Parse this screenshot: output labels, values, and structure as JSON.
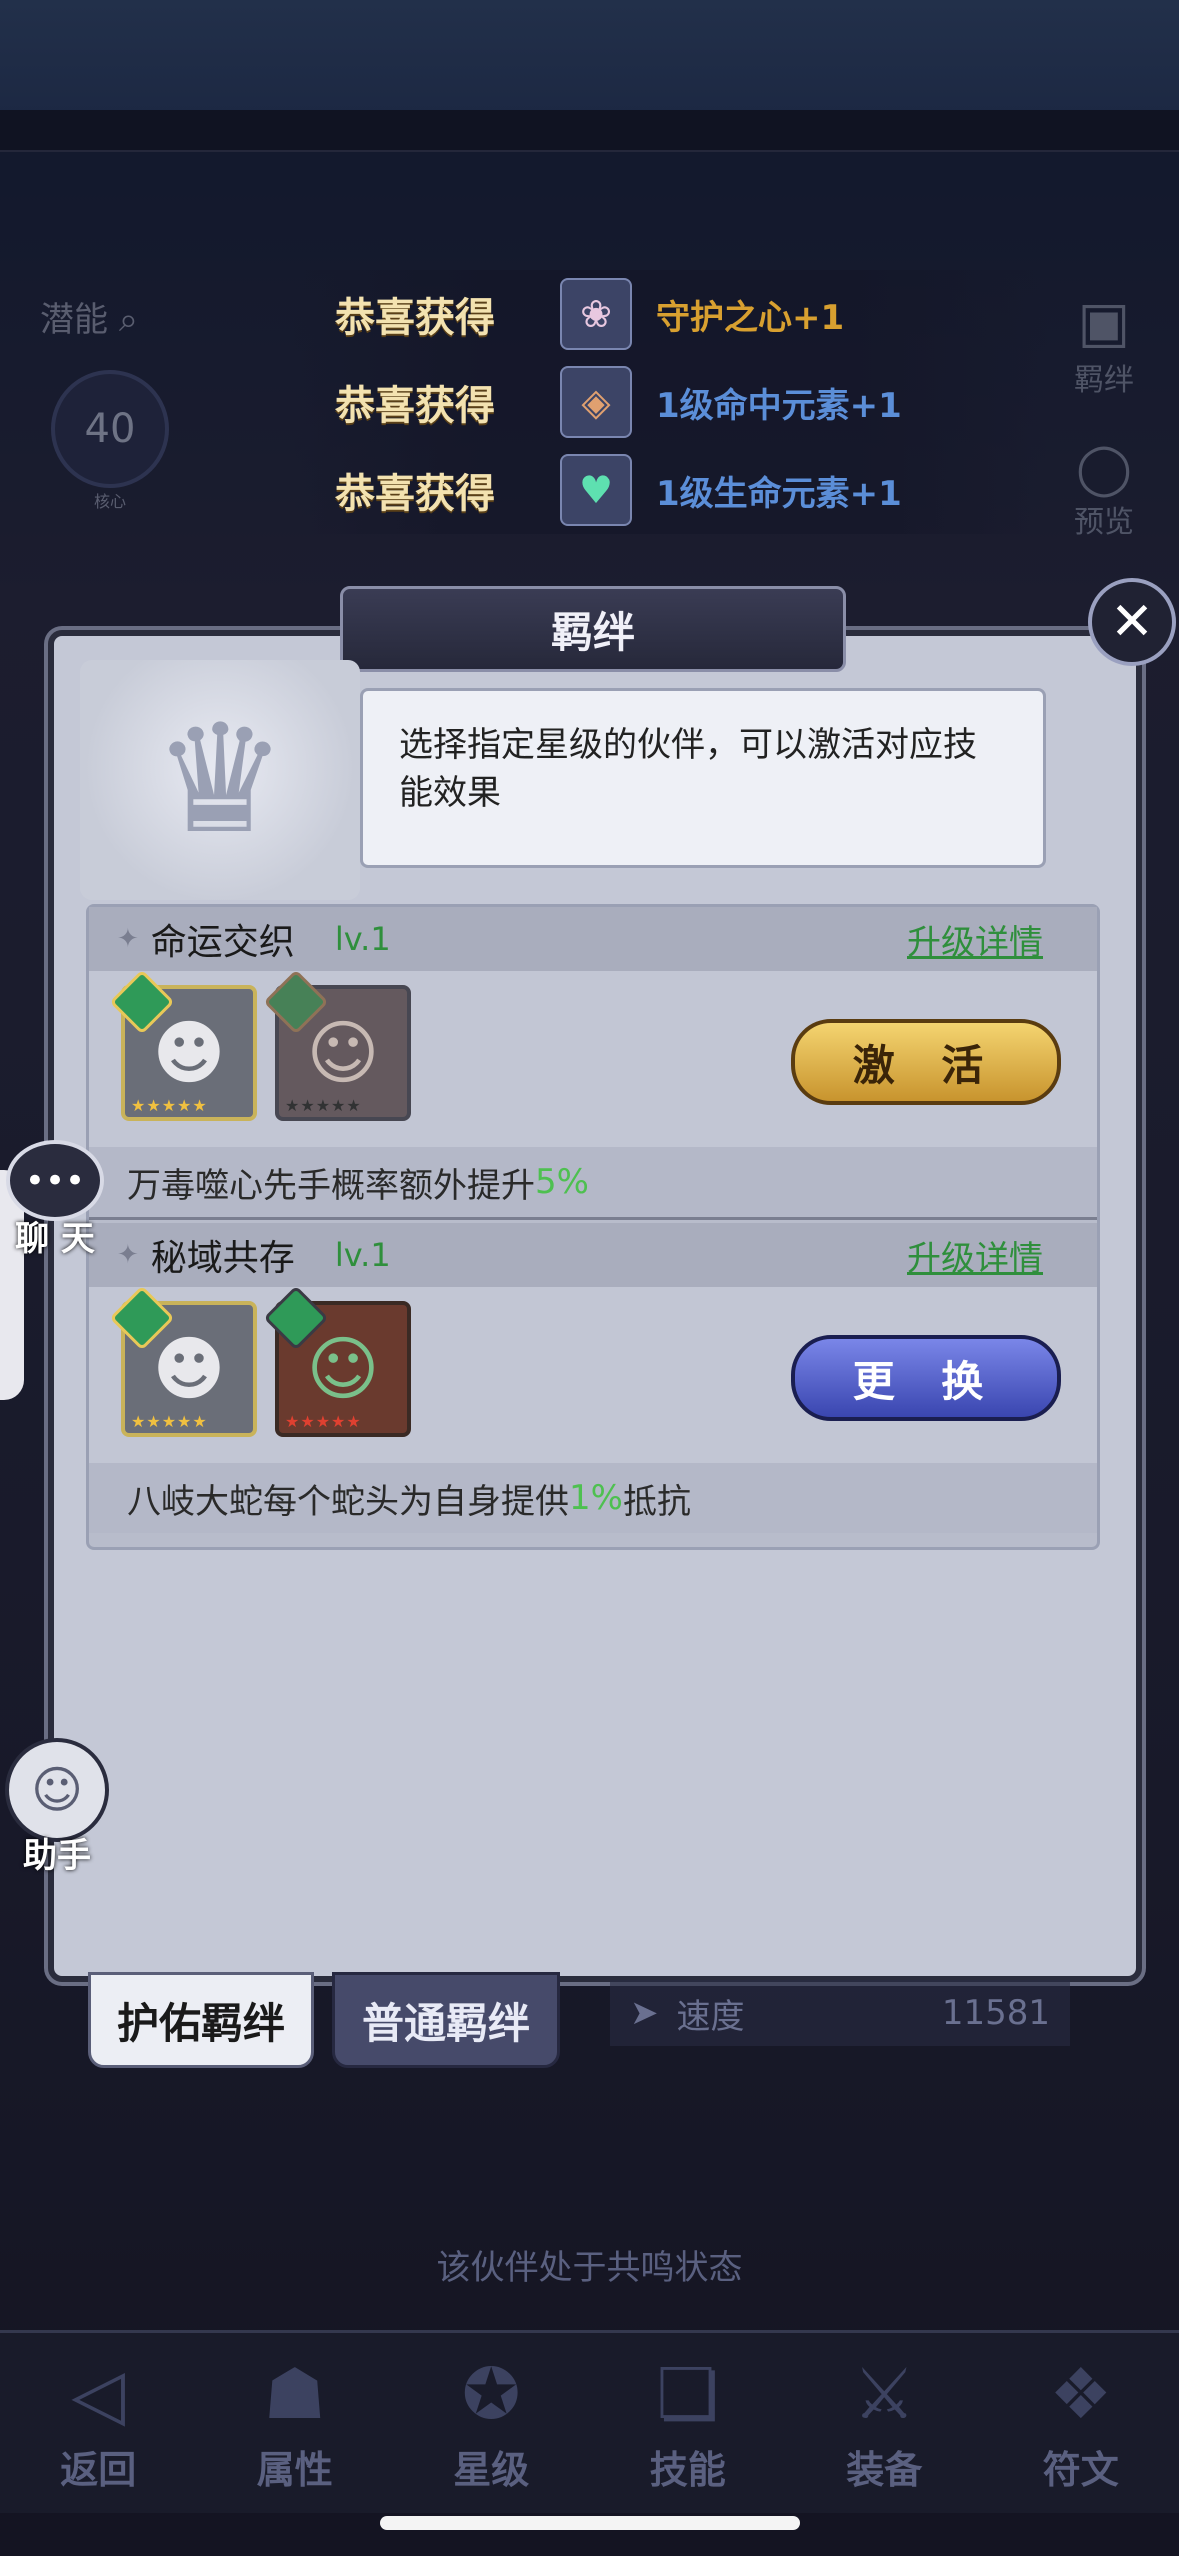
{
  "background": {
    "potential_label": "潜能",
    "core_level": "40",
    "core_label": "核心",
    "right_labels": [
      "羁绊",
      "预览"
    ]
  },
  "toasts": [
    {
      "title": "恭喜获得",
      "icon": "rose-heart-icon",
      "reward": "守护之心+1",
      "color": "gold"
    },
    {
      "title": "恭喜获得",
      "icon": "target-element-icon",
      "reward": "1级命中元素+1",
      "color": "blue"
    },
    {
      "title": "恭喜获得",
      "icon": "heart-element-icon",
      "reward": "1级生命元素+1",
      "color": "blue"
    }
  ],
  "modal": {
    "title": "羁绊",
    "close_icon": "close-icon",
    "hint": "选择指定星级的伙伴，可以激活对应技能效果",
    "bonds": [
      {
        "name": "命运交织",
        "level": "lv.1",
        "detail_link": "升级详情",
        "action_label": "激 活",
        "action_style": "gold",
        "description_prefix": "万毒噬心先手概率额外提升",
        "description_pct": "5%",
        "description_suffix": ""
      },
      {
        "name": "秘域共存",
        "level": "lv.1",
        "detail_link": "升级详情",
        "action_label": "更 换",
        "action_style": "blue",
        "description_prefix": "八岐大蛇每个蛇头为自身提供",
        "description_pct": "1%",
        "description_suffix": "抵抗"
      }
    ]
  },
  "tabs": {
    "active": "护佑羁绊",
    "inactive": "普通羁绊"
  },
  "stat": {
    "label": "速度",
    "value": "11581"
  },
  "resonance_text": "该伙伴处于共鸣状态",
  "nav": [
    {
      "label": "返回",
      "icon": "back-icon"
    },
    {
      "label": "属性",
      "icon": "hood-icon"
    },
    {
      "label": "星级",
      "icon": "star-icon"
    },
    {
      "label": "技能",
      "icon": "scroll-icon"
    },
    {
      "label": "装备",
      "icon": "swords-icon"
    },
    {
      "label": "符文",
      "icon": "rune-icon"
    }
  ],
  "floating": {
    "chat_label": "聊 天",
    "helper_label": "助手"
  },
  "colors": {
    "accent_green": "#2f8f3c",
    "percent_green": "#4ec050",
    "gold_button": "#e0b448",
    "blue_button": "#4a56c8"
  }
}
